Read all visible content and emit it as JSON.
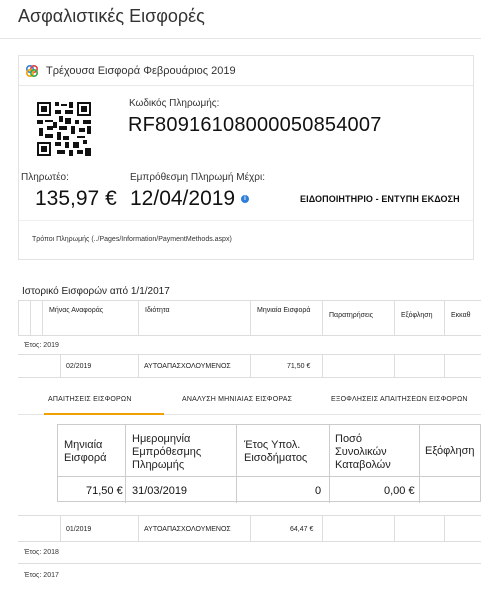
{
  "page": {
    "title": "Ασφαλιστικές Εισφορές"
  },
  "current": {
    "title": "Τρέχουσα Εισφορά Φεβρουάριος 2019",
    "code_label": "Κωδικός Πληρωμής:",
    "code_value": "RF80916108000050854007",
    "payable_label": "Πληρωτέο:",
    "payable_value": "135,97 €",
    "due_label": "Εμπρόθεσμη Πληρωμή Μέχρι:",
    "due_value": "12/04/2019",
    "notice_link": "ΕΙΔΟΠΟΙΗΤΗΡΙΟ - ΕΝΤΥΠΗ ΕΚΔΟΣΗ",
    "methods_link": "Τρόποι Πληρωμής (../Pages/Information/PaymentMethods.aspx)"
  },
  "history": {
    "title": "Ιστορικό Εισφορών από 1/1/2017",
    "columns": [
      "Μήνας Αναφοράς",
      "Ιδιότητα",
      "Μηνιαία Εισφορά",
      "Παρατηρήσεις",
      "Εξόφληση",
      "Εκκαθ"
    ],
    "year_2019": "Έτος: 2019",
    "rows": [
      {
        "month": "02/2019",
        "role": "ΑΥΤΟΑΠΑΣΧΟΛΟΥΜΕΝΟΣ",
        "amount": "71,50 €"
      },
      {
        "month": "01/2019",
        "role": "ΑΥΤΟΑΠΑΣΧΟΛΟΥΜΕΝΟΣ",
        "amount": "64,47 €"
      }
    ],
    "year_2018": "Έτος: 2018",
    "year_2017": "Έτος: 2017"
  },
  "detail": {
    "tabs": [
      "ΑΠΑΙΤΗΣΕΙΣ ΕΙΣΦΟΡΩΝ",
      "ΑΝΑΛΥΣΗ ΜΗΝΙΑΙΑΣ ΕΙΣΦΟΡΑΣ",
      "ΕΞΟΦΛΗΣΕΙΣ ΑΠΑΙΤΗΣΕΩΝ ΕΙΣΦΟΡΩΝ"
    ],
    "columns": [
      "Μηνιαία Εισφορά",
      "Ημερομηνία Εμπρόθεσμης Πληρωμής",
      "Έτος Υπολ. Εισοδήματος",
      "Ποσό Συνολικών Καταβολών",
      "Εξόφληση"
    ],
    "values": [
      "71,50 €",
      "31/03/2019",
      "0",
      "0,00 €",
      ""
    ]
  }
}
